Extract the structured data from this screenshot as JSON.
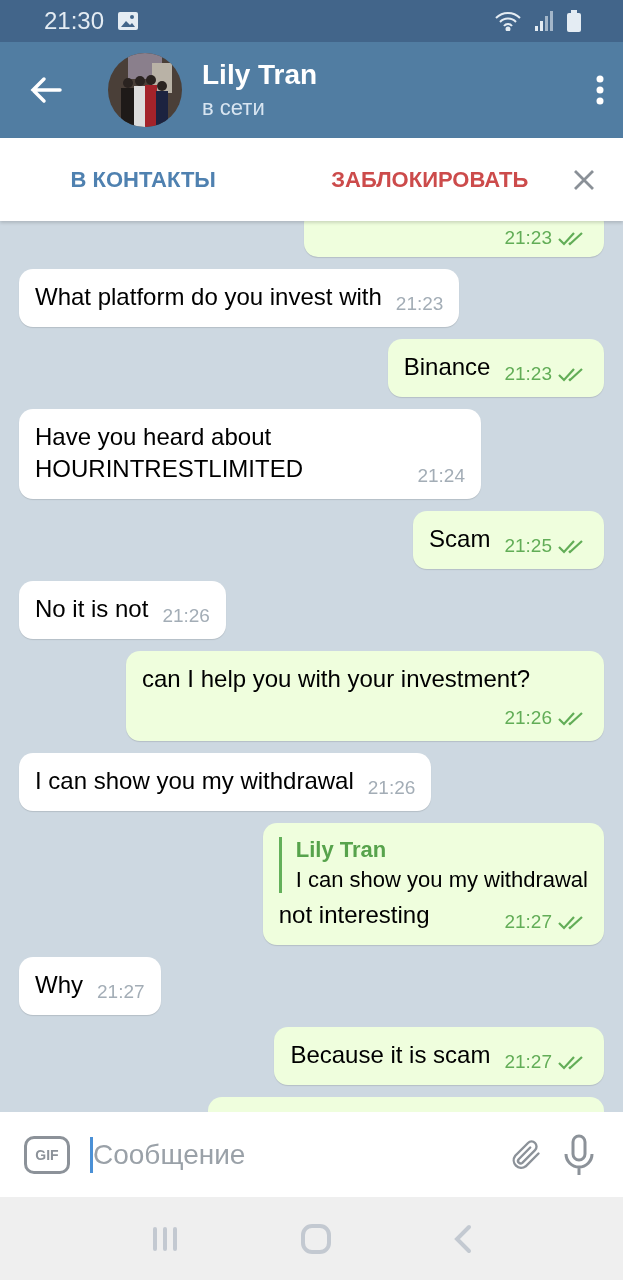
{
  "status_bar": {
    "time": "21:30"
  },
  "header": {
    "name": "Lily Tran",
    "status": "в сети"
  },
  "action_bar": {
    "add_contact": "В КОНТАКТЫ",
    "block": "ЗАБЛОКИРОВАТЬ"
  },
  "messages": [
    {
      "outgoing": true,
      "time": "21:23",
      "read": true
    },
    {
      "outgoing": false,
      "text": "What platform do you invest with",
      "time": "21:23"
    },
    {
      "outgoing": true,
      "text": "Binance",
      "time": "21:23",
      "read": true
    },
    {
      "outgoing": false,
      "text": "Have you heard about HOURINTRESTLIMITED",
      "time": "21:24"
    },
    {
      "outgoing": true,
      "text": "Scam",
      "time": "21:25",
      "read": true
    },
    {
      "outgoing": false,
      "text": "No it is not",
      "time": "21:26"
    },
    {
      "outgoing": true,
      "text": "can I help you with your investment?",
      "time": "21:26",
      "read": true
    },
    {
      "outgoing": false,
      "text": "I can show you my withdrawal",
      "time": "21:26"
    },
    {
      "outgoing": true,
      "reply": {
        "name": "Lily Tran",
        "text": "I can show you my withdrawal"
      },
      "text": "not interesting",
      "time": "21:27",
      "read": true
    },
    {
      "outgoing": false,
      "text": "Why",
      "time": "21:27"
    },
    {
      "outgoing": true,
      "text": "Because it is scam",
      "time": "21:27",
      "read": true
    }
  ],
  "composer": {
    "gif_label": "GIF",
    "placeholder": "Сообщение"
  }
}
